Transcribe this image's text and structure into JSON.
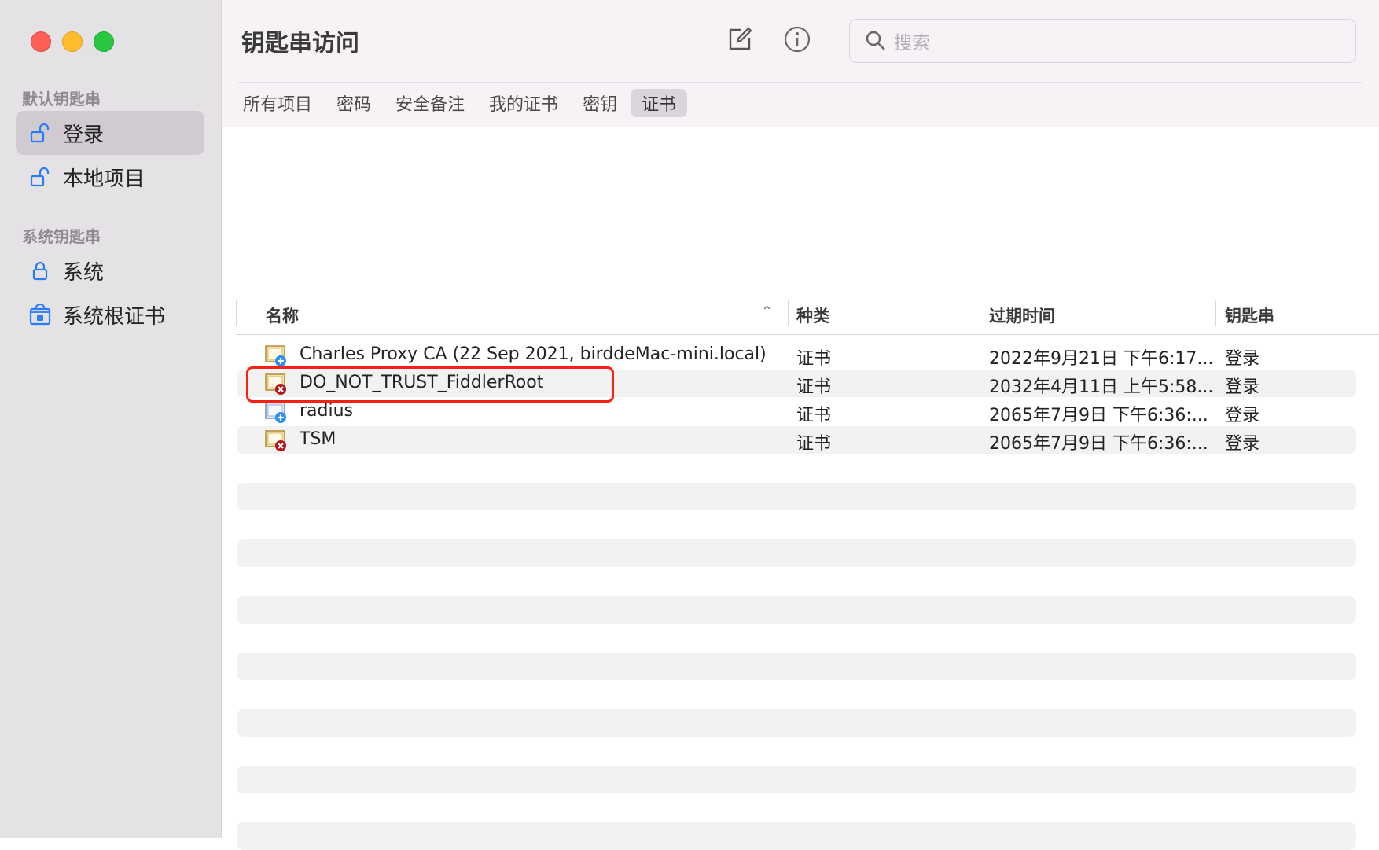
{
  "sidebar": {
    "default_section": "默认钥匙串",
    "system_section": "系统钥匙串",
    "items": [
      {
        "label": "登录",
        "icon": "unlocked-padlock-icon",
        "selected": true
      },
      {
        "label": "本地项目",
        "icon": "unlocked-padlock-icon",
        "selected": false
      },
      {
        "label": "系统",
        "icon": "locked-padlock-icon",
        "selected": false
      },
      {
        "label": "系统根证书",
        "icon": "locked-cabinet-icon",
        "selected": false
      }
    ]
  },
  "toolbar": {
    "title": "钥匙串访问",
    "compose_icon": "compose-icon",
    "info_icon": "info-icon",
    "search_placeholder": "搜索"
  },
  "tabs": [
    "所有项目",
    "密码",
    "安全备注",
    "我的证书",
    "密钥",
    "证书"
  ],
  "active_tab": "证书",
  "table": {
    "columns": {
      "name": "名称",
      "kind": "种类",
      "expires": "过期时间",
      "keychain": "钥匙串"
    },
    "rows": [
      {
        "name": "Charles Proxy CA (22 Sep 2021, birddeMac-mini.local)",
        "kind": "证书",
        "expires": "2022年9月21日 下午6:17...",
        "keychain": "登录",
        "icon": "certificate-trusted-icon"
      },
      {
        "name": "DO_NOT_TRUST_FiddlerRoot",
        "kind": "证书",
        "expires": "2032年4月11日 上午5:58...",
        "keychain": "登录",
        "icon": "certificate-untrusted-icon"
      },
      {
        "name": "radius",
        "kind": "证书",
        "expires": "2065年7月9日 下午6:36:...",
        "keychain": "登录",
        "icon": "certificate-trusted-icon"
      },
      {
        "name": "TSM",
        "kind": "证书",
        "expires": "2065年7月9日 下午6:36:...",
        "keychain": "登录",
        "icon": "certificate-untrusted-icon"
      }
    ]
  },
  "colors": {
    "highlight": "#ff1f13",
    "accent": "#2a7bf6",
    "sidebar_bg": "#e5e2e6"
  }
}
